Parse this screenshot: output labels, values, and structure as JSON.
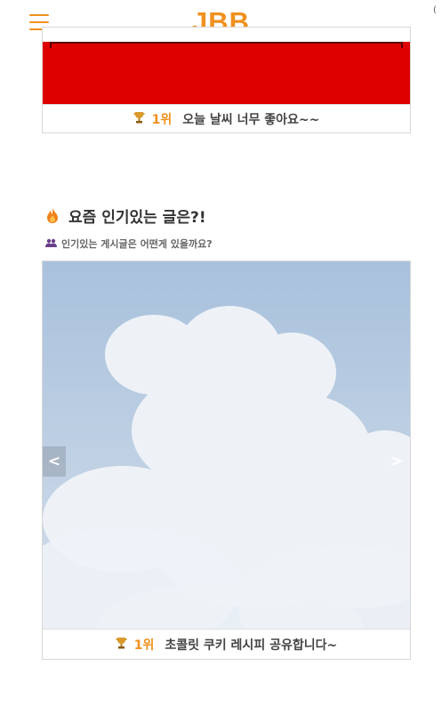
{
  "header": {
    "logo": "JBB",
    "menu_icon": "hamburger-menu-icon",
    "corner_mark": "("
  },
  "top_card": {
    "rank_icon": "trophy-icon",
    "rank": "1위",
    "title": "오늘 날씨 너무 좋아요~~",
    "banner_color": "#de0000"
  },
  "popular": {
    "title": "요즘 인기있는 글은?!",
    "title_icon": "flame-icon",
    "subtitle": "인기있는 게시글은 어떤게 있을까요?",
    "subtitle_icon": "people-icon",
    "carousel": {
      "prev_label": "<",
      "next_label": ">",
      "rank_icon": "trophy-icon",
      "rank": "1위",
      "title": "초콜릿 쿠키 레시피 공유합니다~"
    }
  },
  "colors": {
    "accent": "#f0901e",
    "text": "#444444"
  }
}
